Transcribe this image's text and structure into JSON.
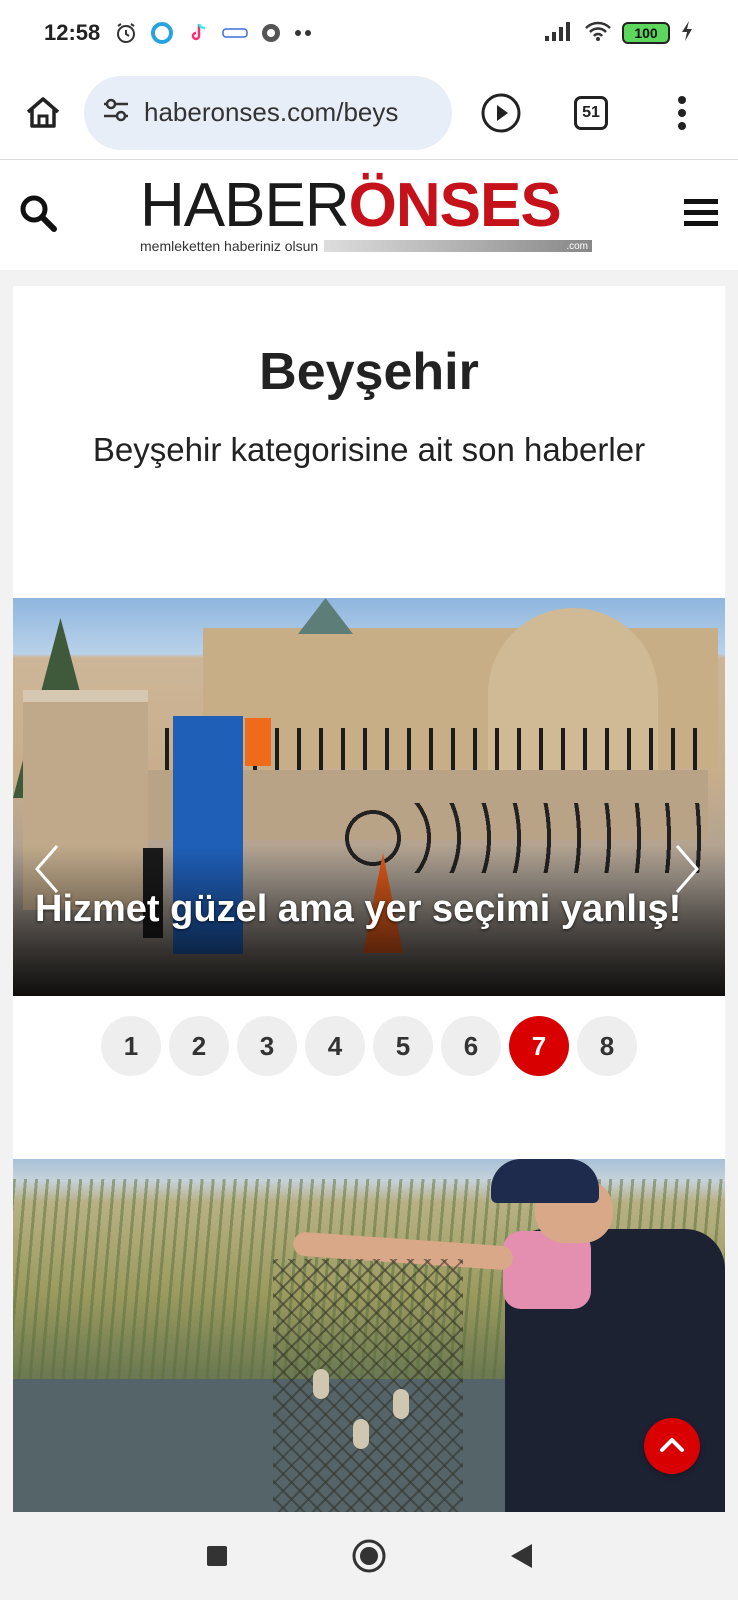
{
  "status_bar": {
    "time": "12:58",
    "battery": "100",
    "left_icons": [
      "alarm-icon",
      "circle-app-icon",
      "tiktok-icon",
      "cimri-icon",
      "chrome-icon",
      "more-dots-icon"
    ],
    "right_icons": [
      "signal-icon",
      "wifi-icon",
      "battery-icon",
      "charging-icon"
    ]
  },
  "browser": {
    "url": "haberonses.com/beys",
    "tab_count": "51",
    "icons": [
      "home-icon",
      "site-settings-icon",
      "play-icon",
      "tabs-icon",
      "menu-dots-icon"
    ]
  },
  "site_header": {
    "logo_part1": "HABER",
    "logo_part2": "ÖNSES",
    "tagline": "memleketten haberiniz olsun",
    "logo_suffix": ".com",
    "icons": [
      "search-icon",
      "hamburger-menu-icon"
    ]
  },
  "category": {
    "title": "Beyşehir",
    "description": "Beyşehir kategorisine ait son haberler"
  },
  "slider": {
    "caption": "Hizmet güzel ama yer seçimi yanlış!",
    "prev_icon": "chevron-left-icon",
    "next_icon": "chevron-right-icon",
    "pages": [
      "1",
      "2",
      "3",
      "4",
      "5",
      "6",
      "7",
      "8"
    ],
    "active_page": "7"
  },
  "floating": {
    "scroll_top_icon": "chevron-up-icon"
  },
  "nav_bar": {
    "icons": [
      "recents-square-icon",
      "home-circle-icon",
      "back-triangle-icon"
    ]
  },
  "colors": {
    "brand_red": "#c4111a",
    "active_page": "#d80000",
    "url_bg": "#e8eef8"
  }
}
